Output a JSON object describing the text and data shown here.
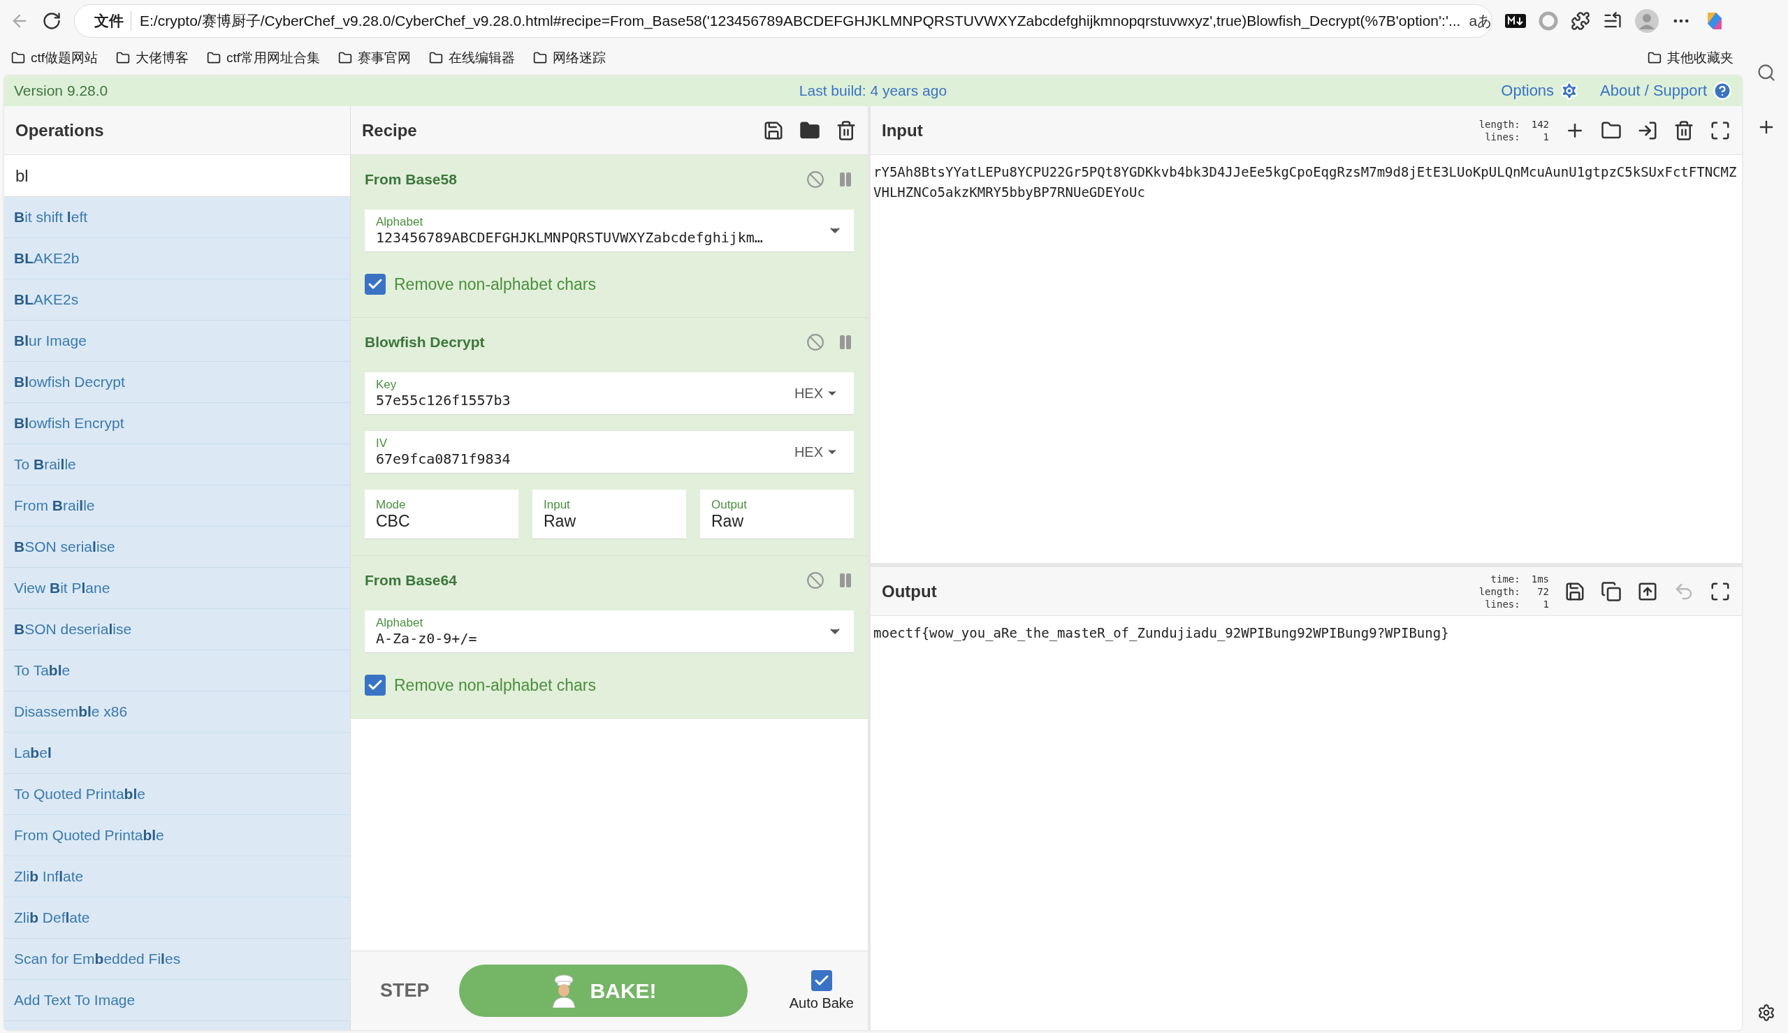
{
  "browser": {
    "address_prefix": "文件",
    "url": "E:/crypto/赛博厨子/CyberChef_v9.28.0/CyberChef_v9.28.0.html#recipe=From_Base58('123456789ABCDEFGHJKLMNPQRSTUVWXYZabcdefghijkmnopqrstuvwxyz',true)Blowfish_Decrypt(%7B'option':'...",
    "read_aloud": "aあ",
    "bookmarks": [
      "ctf做题网站",
      "大佬博客",
      "ctf常用网址合集",
      "赛事官网",
      "在线编辑器",
      "网络迷踪"
    ],
    "other_bookmarks": "其他收藏夹"
  },
  "banner": {
    "version": "Version 9.28.0",
    "last_build": "Last build: 4 years ago",
    "options": "Options",
    "about": "About / Support"
  },
  "operations": {
    "title": "Operations",
    "search_value": "bl",
    "items": [
      {
        "label": "**B**it shift **l**eft"
      },
      {
        "label": "**BL**AKE2b"
      },
      {
        "label": "**BL**AKE2s"
      },
      {
        "label": "**Bl**ur Image"
      },
      {
        "label": "**Bl**owfish Decrypt"
      },
      {
        "label": "**Bl**owfish Encrypt"
      },
      {
        "label": "To **B**rai**l**le"
      },
      {
        "label": "From **B**rai**l**le"
      },
      {
        "label": "**B**SON seria**l**ise"
      },
      {
        "label": "View **B**it P**l**ane"
      },
      {
        "label": "**B**SON deseria**l**ise"
      },
      {
        "label": "To Ta**bl**e"
      },
      {
        "label": "Disassem**bl**e x86"
      },
      {
        "label": "La**b**e**l**"
      },
      {
        "label": "To Quoted Printa**bl**e"
      },
      {
        "label": "From Quoted Printa**bl**e"
      },
      {
        "label": "Zli**b** Inf**l**ate"
      },
      {
        "label": "Zli**b** Def**l**ate"
      },
      {
        "label": "Scan for Em**b**edded Fi**l**es"
      },
      {
        "label": "Add Text To Image"
      }
    ]
  },
  "recipe": {
    "title": "Recipe",
    "ops": [
      {
        "name": "From Base58",
        "args": [
          {
            "kind": "editable",
            "label": "Alphabet",
            "value": "123456789ABCDEFGHJKLMNPQRSTUVWXYZabcdefghijkm…"
          },
          {
            "kind": "checkbox",
            "label": "Remove non-alphabet chars",
            "checked": true
          }
        ]
      },
      {
        "name": "Blowfish Decrypt",
        "args": [
          {
            "kind": "toggle",
            "label": "Key",
            "value": "57e55c126f1557b3",
            "toggle": "HEX"
          },
          {
            "kind": "toggle",
            "label": "IV",
            "value": "67e9fca0871f9834",
            "toggle": "HEX"
          },
          {
            "kind": "option",
            "label": "Mode",
            "value": "CBC"
          },
          {
            "kind": "option",
            "label": "Input",
            "value": "Raw"
          },
          {
            "kind": "option",
            "label": "Output",
            "value": "Raw"
          }
        ]
      },
      {
        "name": "From Base64",
        "args": [
          {
            "kind": "editable",
            "label": "Alphabet",
            "value": "A-Za-z0-9+/="
          },
          {
            "kind": "checkbox",
            "label": "Remove non-alphabet chars",
            "checked": true
          }
        ]
      }
    ],
    "step": "STEP",
    "bake": "BAKE!",
    "auto_bake": {
      "label": "Auto Bake",
      "checked": true
    }
  },
  "input": {
    "title": "Input",
    "stats": [
      {
        "label": "length:",
        "value": "142"
      },
      {
        "label": "lines:",
        "value": "1"
      }
    ],
    "text": "rY5Ah8BtsYYatLEPu8YCPU22Gr5PQt8YGDKkvb4bk3D4JJeEe5kgCpoEqgRzsM7m9d8jEtE3LUoKpULQnMcuAunU1gtpzC5kSUxFctFTNCMZVHLHZNCo5akzKMRY5bbyBP7RNUeGDEYoUc"
  },
  "output": {
    "title": "Output",
    "stats": [
      {
        "label": "time:",
        "value": "1ms"
      },
      {
        "label": "length:",
        "value": "72"
      },
      {
        "label": "lines:",
        "value": "1"
      }
    ],
    "text": "moectf{wow_you_aRe_the_masteR_of_Zundujiadu_92WPIBung92WPIBung9?WPIBung}"
  }
}
